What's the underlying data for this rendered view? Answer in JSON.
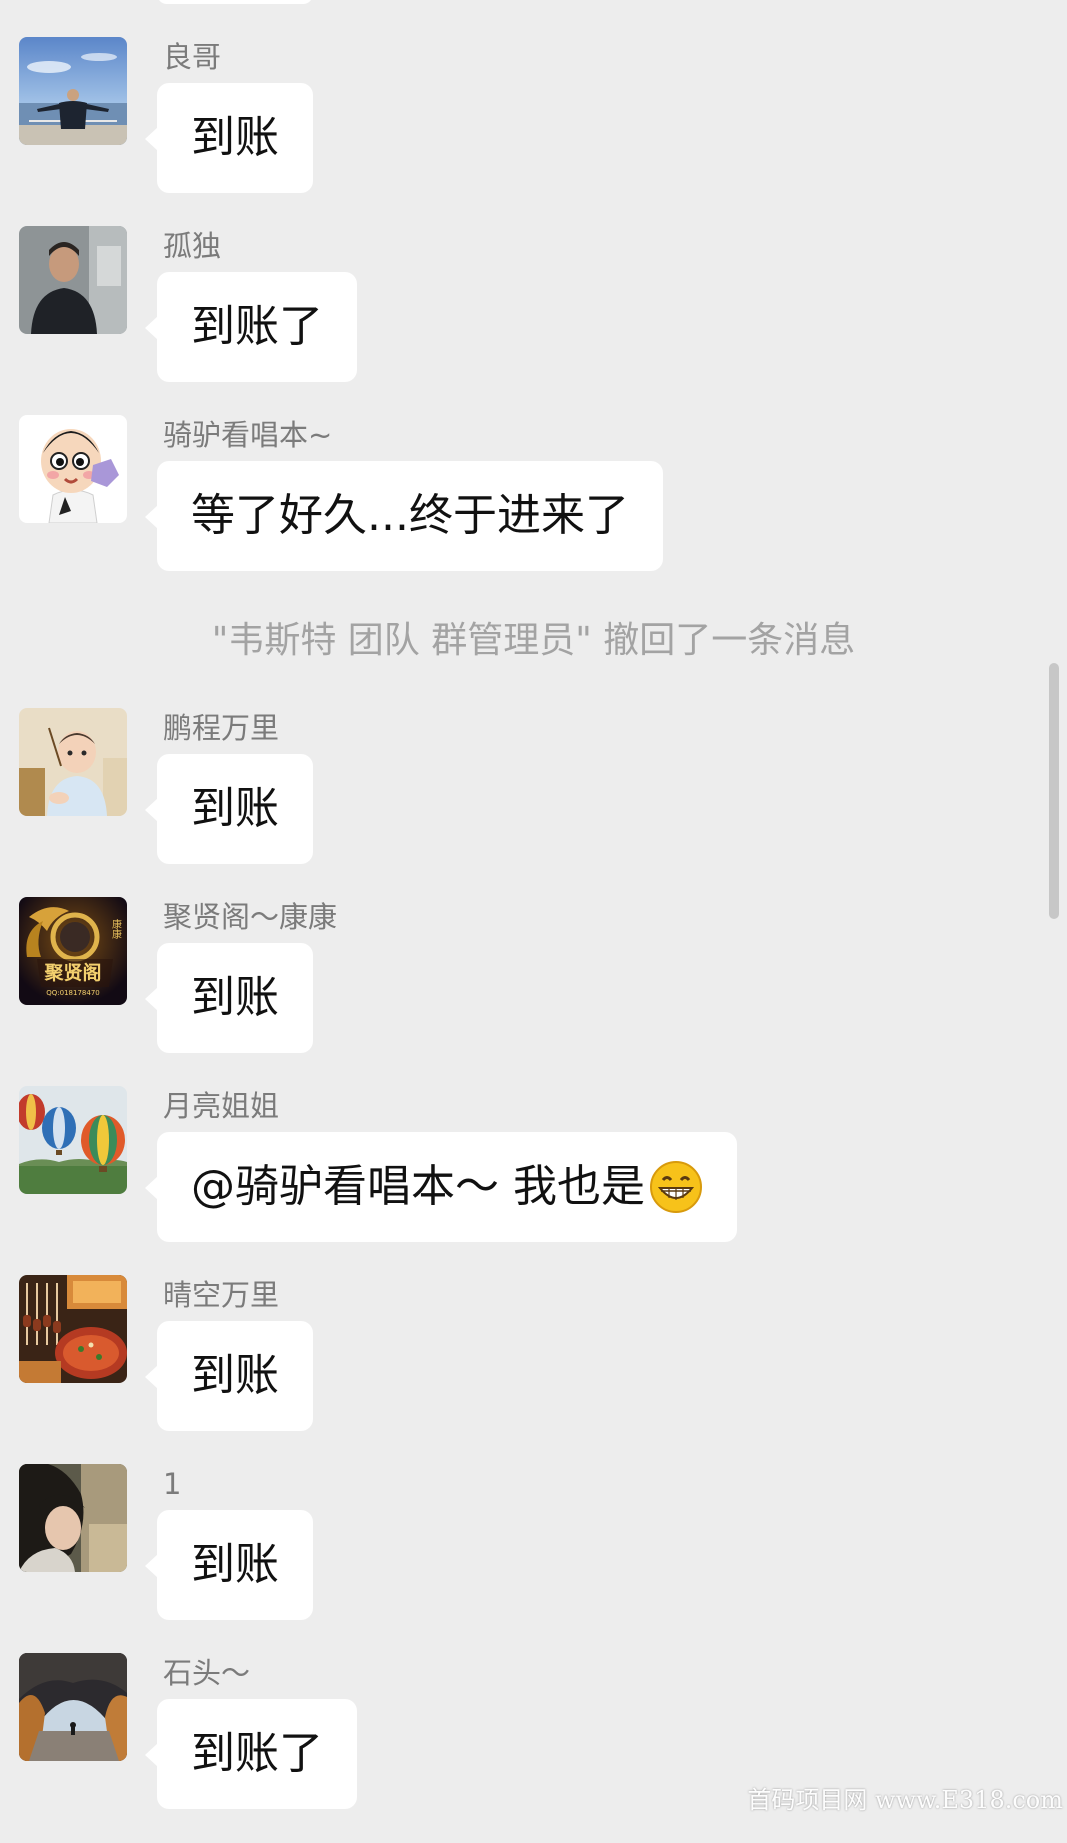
{
  "messages": [
    {
      "sender": "良哥",
      "text": "到账",
      "avatar_icon": "man-sea-photo"
    },
    {
      "sender": "孤独",
      "text": "到账了",
      "avatar_icon": "man-portrait-photo"
    },
    {
      "sender": "骑驴看唱本~",
      "text": "等了好久...终于进来了",
      "avatar_icon": "cartoon-boy"
    },
    {
      "sender": "鹏程万里",
      "text": "到账",
      "avatar_icon": "baby-photo"
    },
    {
      "sender": "聚贤阁～康康",
      "text": "到账",
      "avatar_icon": "golden-dragon-logo",
      "avatar_text": "聚贤阁",
      "avatar_subtext": "QQ:018178470",
      "avatar_side_text": "康康"
    },
    {
      "sender": "月亮姐姐",
      "text": "@骑驴看唱本～ 我也是",
      "emoji": "grinning-face",
      "avatar_icon": "hot-air-balloons"
    },
    {
      "sender": "晴空万里",
      "text": "到账",
      "avatar_icon": "food-skewers-photo"
    },
    {
      "sender": "1",
      "text": "到账",
      "avatar_icon": "person-hair-photo"
    },
    {
      "sender": "石头～",
      "text": "到账了",
      "avatar_icon": "rock-arch-photo"
    }
  ],
  "system_notice": "\"韦斯特  团队  群管理员\" 撤回了一条消息",
  "watermark": "首码项目网  www.E318.com",
  "colors": {
    "background": "#ededed",
    "bubble": "#ffffff",
    "sender_name": "#7b7b7b",
    "system_text": "#a3a3a3"
  }
}
